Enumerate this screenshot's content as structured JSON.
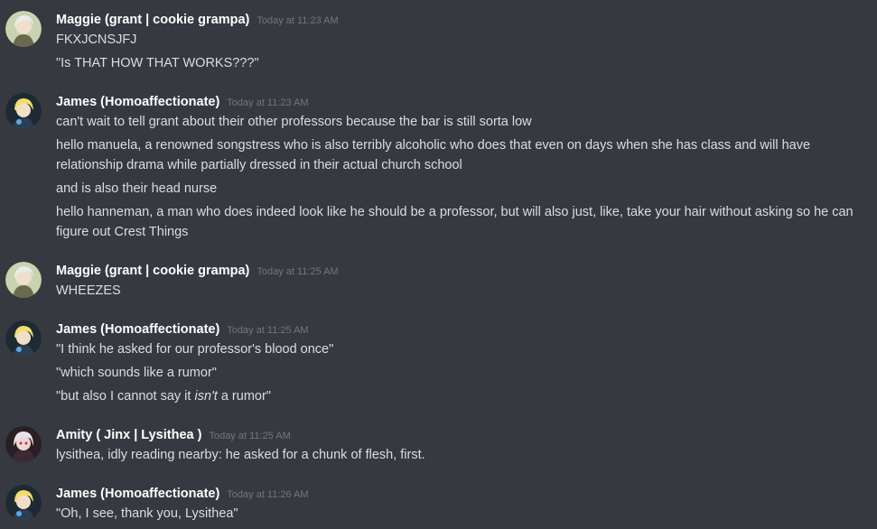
{
  "groups": [
    {
      "author": "Maggie (grant | cookie grampa)",
      "timestamp": "Today at 11:23 AM",
      "avatar": "maggie-avatar",
      "messages": [
        "FKXJCNSJFJ",
        "\"Is THAT HOW THAT WORKS???\""
      ]
    },
    {
      "author": "James (Homoaffectionate)",
      "timestamp": "Today at 11:23 AM",
      "avatar": "james-avatar",
      "messages": [
        "can't wait to tell grant about their other professors because the bar is still sorta low",
        "hello manuela, a renowned songstress who is also terribly alcoholic who does that even on days when she has class and will have relationship drama while partially dressed in their actual church school",
        "and is also their head nurse",
        "hello hanneman, a man who does indeed look like he should be a professor, but will also just, like, take your hair without asking so he can figure out Crest Things"
      ]
    },
    {
      "author": "Maggie (grant | cookie grampa)",
      "timestamp": "Today at 11:25 AM",
      "avatar": "maggie-avatar",
      "messages": [
        "WHEEZES"
      ]
    },
    {
      "author": "James (Homoaffectionate)",
      "timestamp": "Today at 11:25 AM",
      "avatar": "james-avatar",
      "messages": [
        "\"I think he asked for our professor's blood once\"",
        "\"which sounds like a rumor\"",
        {
          "before": "\"but also I cannot say it ",
          "italic": "isn't",
          "after": " a rumor\""
        }
      ]
    },
    {
      "author": "Amity ( Jinx | Lysithea )",
      "timestamp": "Today at 11:25 AM",
      "avatar": "amity-avatar",
      "messages": [
        "lysithea, idly reading nearby: he asked for a chunk of flesh, first."
      ]
    },
    {
      "author": "James (Homoaffectionate)",
      "timestamp": "Today at 11:26 AM",
      "avatar": "james-avatar",
      "messages": [
        "\"Oh, I see, thank you, Lysithea\""
      ]
    }
  ],
  "colors": {
    "background": "#36393f",
    "username": "#ffffff",
    "timestamp": "#72767d",
    "message": "#dcddde"
  }
}
